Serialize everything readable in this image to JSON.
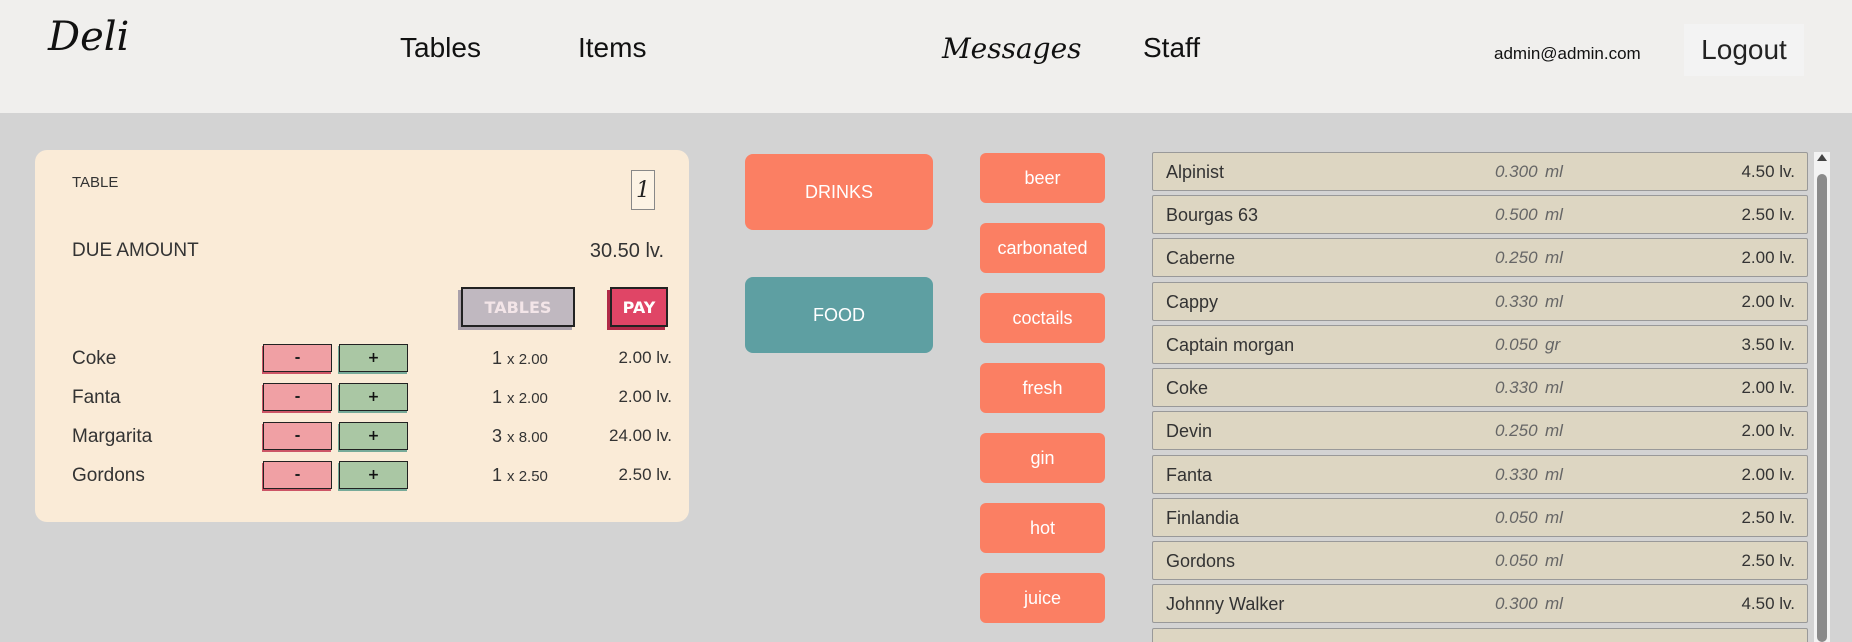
{
  "header": {
    "logo": "Deli",
    "nav": [
      "Tables",
      "Items",
      "Messages",
      "Staff"
    ],
    "user_email": "admin@admin.com",
    "logout_label": "Logout"
  },
  "order": {
    "table_label": "TABLE",
    "table_number": "1",
    "due_label": "DUE AMOUNT",
    "due_value": "30.50 lv.",
    "tables_button": "TABLES",
    "pay_button": "PAY",
    "minus_label": "-",
    "plus_label": "+",
    "items": [
      {
        "name": "Coke",
        "qty": "1",
        "unit_price": "x 2.00",
        "total": "2.00 lv."
      },
      {
        "name": "Fanta",
        "qty": "1",
        "unit_price": "x 2.00",
        "total": "2.00 lv."
      },
      {
        "name": "Margarita",
        "qty": "3",
        "unit_price": "x 8.00",
        "total": "24.00 lv."
      },
      {
        "name": "Gordons",
        "qty": "1",
        "unit_price": "x 2.50",
        "total": "2.50 lv."
      }
    ]
  },
  "categories": [
    "DRINKS",
    "FOOD"
  ],
  "subcategories": [
    "beer",
    "carbonated",
    "coctails",
    "fresh",
    "gin",
    "hot",
    "juice"
  ],
  "products": [
    {
      "name": "Alpinist",
      "qty": "0.300",
      "unit": "ml",
      "price": "4.50 lv."
    },
    {
      "name": "Bourgas 63",
      "qty": "0.500",
      "unit": "ml",
      "price": "2.50 lv."
    },
    {
      "name": "Caberne",
      "qty": "0.250",
      "unit": "ml",
      "price": "2.00 lv."
    },
    {
      "name": "Cappy",
      "qty": "0.330",
      "unit": "ml",
      "price": "2.00 lv."
    },
    {
      "name": "Captain morgan",
      "qty": "0.050",
      "unit": "gr",
      "price": "3.50 lv."
    },
    {
      "name": "Coke",
      "qty": "0.330",
      "unit": "ml",
      "price": "2.00 lv."
    },
    {
      "name": "Devin",
      "qty": "0.250",
      "unit": "ml",
      "price": "2.00 lv."
    },
    {
      "name": "Fanta",
      "qty": "0.330",
      "unit": "ml",
      "price": "2.00 lv."
    },
    {
      "name": "Finlandia",
      "qty": "0.050",
      "unit": "ml",
      "price": "2.50 lv."
    },
    {
      "name": "Gordons",
      "qty": "0.050",
      "unit": "ml",
      "price": "2.50 lv."
    },
    {
      "name": "Johnny Walker",
      "qty": "0.300",
      "unit": "ml",
      "price": "4.50 lv."
    }
  ],
  "colors": {
    "header_bg": "#f0efed",
    "page_bg": "#d3d3d3",
    "order_panel_bg": "#faebd7",
    "drinks": "#fb7f63",
    "food": "#5e9fa2",
    "product_bg": "#ddd6c2",
    "pay": "#e04566",
    "minus": "#f0a0a4",
    "plus": "#aac7a4"
  }
}
